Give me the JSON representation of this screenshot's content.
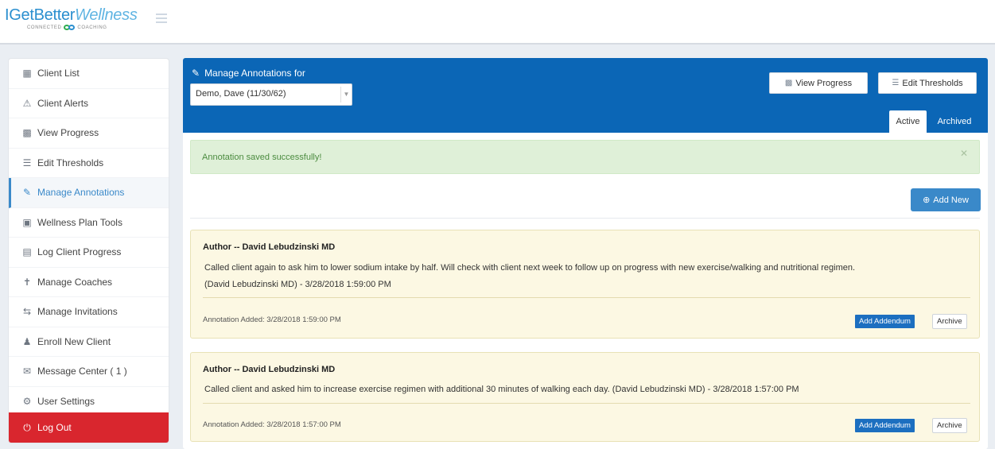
{
  "header": {
    "logo_main_a": "IGetBetter",
    "logo_main_b": "Wellness",
    "logo_sub_a": "CONNECTED",
    "logo_sub_b": "COACHING",
    "menu_icon": "hamburger-icon"
  },
  "sidebar": {
    "items": [
      {
        "label": "Client List",
        "icon": "client-list-icon"
      },
      {
        "label": "Client Alerts",
        "icon": "warning-icon"
      },
      {
        "label": "View Progress",
        "icon": "bar-chart-icon"
      },
      {
        "label": "Edit Thresholds",
        "icon": "list-icon"
      },
      {
        "label": "Manage Annotations",
        "icon": "edit-icon",
        "active": true
      },
      {
        "label": "Wellness Plan Tools",
        "icon": "tools-icon"
      },
      {
        "label": "Log Client Progress",
        "icon": "document-icon"
      },
      {
        "label": "Manage Coaches",
        "icon": "coach-icon"
      },
      {
        "label": "Manage Invitations",
        "icon": "transfer-icon"
      },
      {
        "label": "Enroll New Client",
        "icon": "add-user-icon"
      },
      {
        "label": "Message Center ( 1 )",
        "icon": "envelope-icon"
      },
      {
        "label": "User Settings",
        "icon": "gear-icon"
      }
    ],
    "logout_label": "Log Out",
    "logout_icon": "power-icon"
  },
  "panel": {
    "title": "Manage Annotations for",
    "client_select_value": "Demo, Dave (11/30/62)",
    "view_progress_label": "View Progress",
    "edit_thresholds_label": "Edit Thresholds",
    "tabs": [
      {
        "label": "Active",
        "active": true
      },
      {
        "label": "Archived",
        "active": false
      }
    ],
    "alert_text": "Annotation saved successfully!",
    "add_new_label": "Add New"
  },
  "annotations": [
    {
      "author": "Author -- David Lebudzinski MD",
      "text_line1": "Called client again to ask him to lower sodium intake by half. Will check with client next week to follow up on progress with new exercise/walking and nutritional regimen.",
      "text_line2": "(David Lebudzinski MD) - 3/28/2018 1:59:00 PM",
      "added": "Annotation Added: 3/28/2018 1:59:00 PM",
      "addendum_label": "Add Addendum",
      "archive_label": "Archive"
    },
    {
      "author": "Author -- David Lebudzinski MD",
      "text_line1": "Called client and asked him to increase exercise regimen with additional 30 minutes of walking each day. (David Lebudzinski MD) - 3/28/2018 1:57:00 PM",
      "added": "Annotation Added: 3/28/2018 1:57:00 PM",
      "addendum_label": "Add Addendum",
      "archive_label": "Archive"
    }
  ],
  "colors": {
    "brand_blue": "#0b66b6",
    "logout_red": "#d9262e",
    "alert_green_bg": "#dff0d8",
    "card_yellow_bg": "#fcf8e3"
  }
}
